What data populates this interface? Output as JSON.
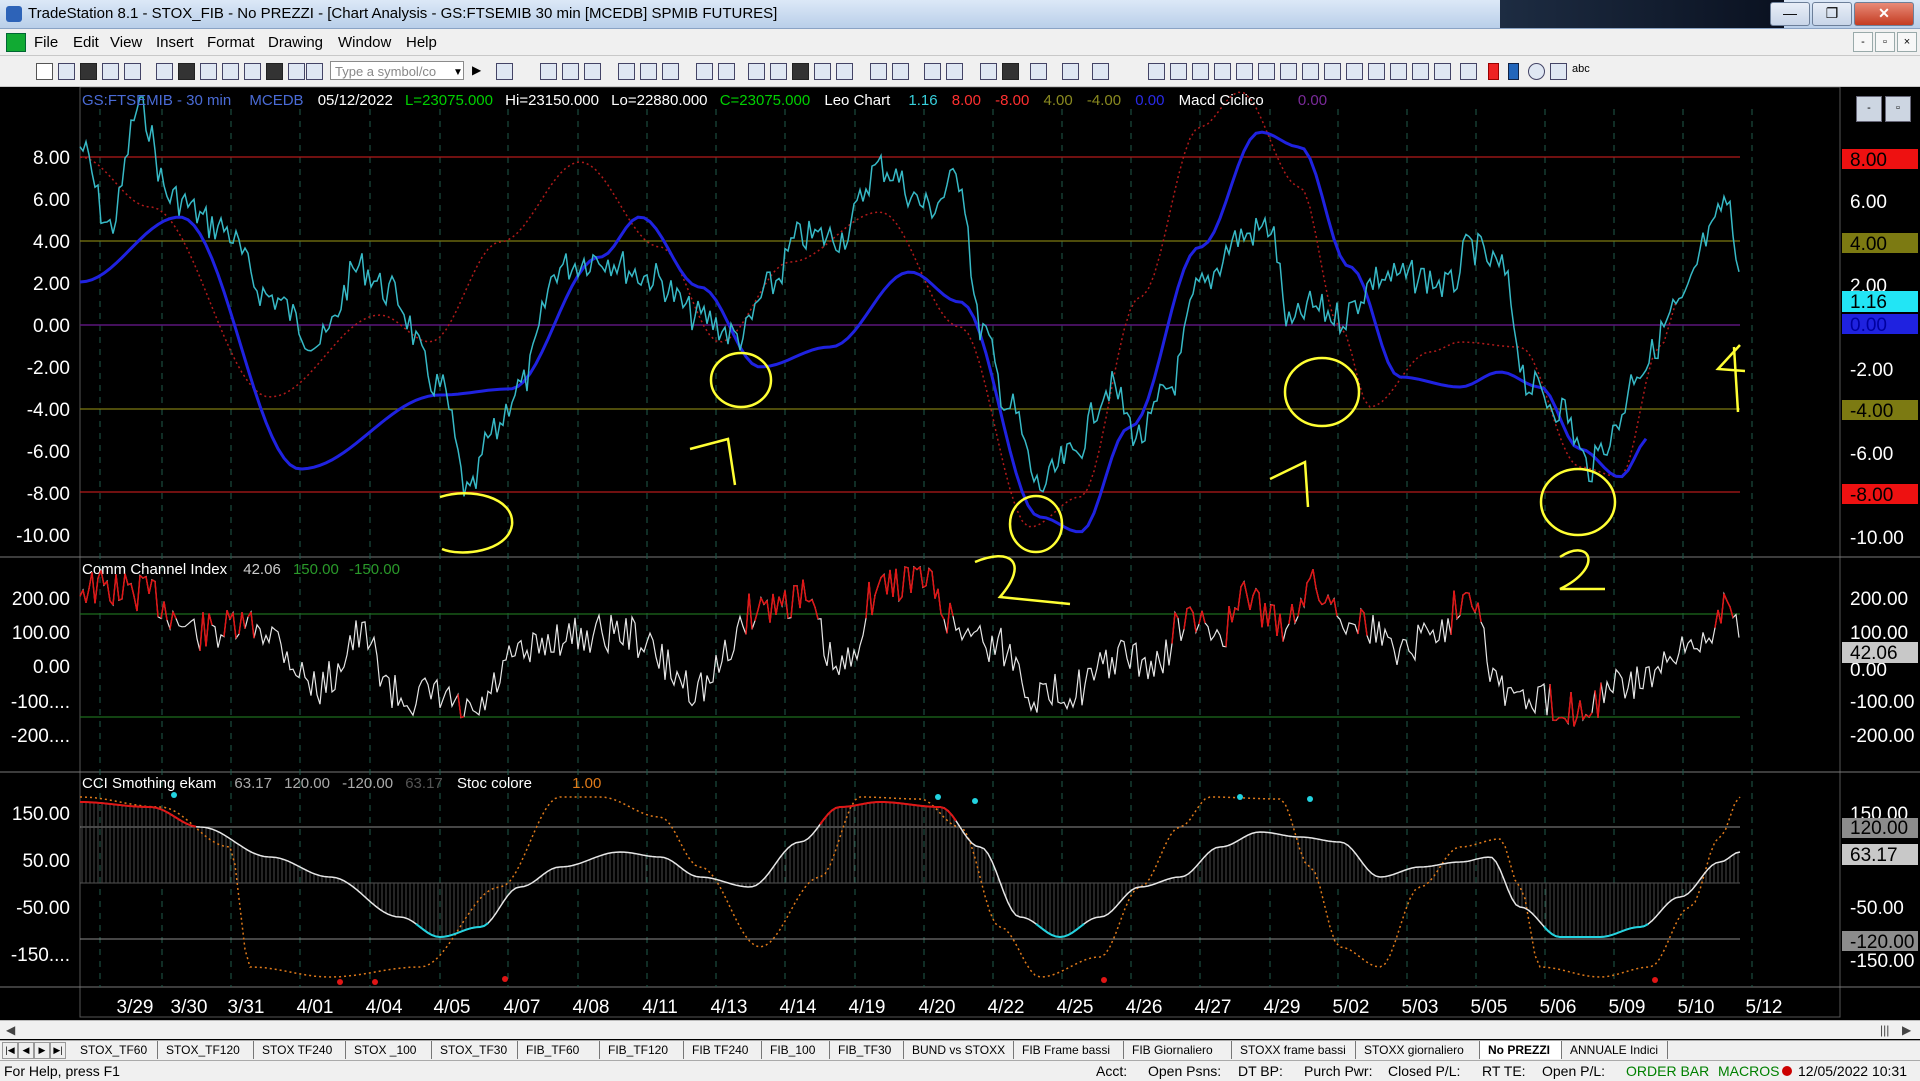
{
  "window": {
    "title": "TradeStation 8.1 - STOX_FIB - No PREZZI - [Chart Analysis - GS:FTSEMIB  30 min  [MCEDB] SPMIB FUTURES]",
    "min_glyph": "—",
    "restore_glyph": "❐",
    "close_glyph": "✕",
    "mdi_min": "-",
    "mdi_restore": "▫",
    "mdi_close": "×"
  },
  "menu": {
    "items": [
      "File",
      "Edit",
      "View",
      "Insert",
      "Format",
      "Drawing",
      "Window",
      "Help"
    ]
  },
  "toolbar": {
    "symbol_placeholder": "Type a symbol/co",
    "dropdown_glyph": "▼",
    "abc_label": "abc"
  },
  "chart_header": {
    "symbol": "GS:FTSEMIB - 30 min",
    "datasource": "MCEDB",
    "date": "05/12/2022",
    "last": "L=23075.000",
    "high": "Hi=23150.000",
    "low": "Lo=22880.000",
    "close": "C=23075.000",
    "indicator1": "Leo Chart",
    "ind_values": [
      "1.16",
      "8.00",
      "-8.00",
      "4.00",
      "-4.00",
      "0.00"
    ],
    "indicator2": "Macd Ciclico",
    "ind2_value": "0.00"
  },
  "panel1": {
    "y_labels": [
      "8.00",
      "6.00",
      "4.00",
      "2.00",
      "0.00",
      "-2.00",
      "-4.00",
      "-6.00",
      "-8.00",
      "-10.00"
    ],
    "right_labels": [
      "8.00",
      "6.00",
      "4.00",
      "2.00",
      "1.16",
      "0.00",
      "-2.00",
      "-4.00",
      "-6.00",
      "-8.00",
      "-10.00"
    ],
    "colors": {
      "cyan": "#37b9c6",
      "blue": "#1f22e0",
      "red": "#b31b1b",
      "yellow": "#ffff33"
    }
  },
  "panel2": {
    "title": "Comm Channel Index",
    "value": "42.06",
    "upper": "150.00",
    "lower": "-150.00",
    "y_labels": [
      "200.00",
      "100.00",
      "0.00",
      "-100....",
      "-200...."
    ],
    "right_labels": [
      "200.00",
      "100.00",
      "42.06",
      "0.00",
      "-100.00",
      "-200.00"
    ]
  },
  "panel3": {
    "title": "CCI Smothing ekam",
    "values": [
      "63.17",
      "120.00",
      "-120.00",
      "63.17"
    ],
    "stoc_title": "Stoc colore",
    "stoc_value": "1.00",
    "y_labels": [
      "150.00",
      "50.00",
      "-50.00",
      "-150...."
    ],
    "right_labels": [
      "150.00",
      "120.00",
      "63.17",
      "-50.00",
      "-120.00",
      "-150.00"
    ]
  },
  "x_axis": {
    "dates": [
      "3/29",
      "3/30",
      "3/31",
      "4/01",
      "4/04",
      "4/05",
      "4/07",
      "4/08",
      "4/11",
      "4/13",
      "4/14",
      "4/19",
      "4/20",
      "4/22",
      "4/25",
      "4/26",
      "4/27",
      "4/29",
      "5/02",
      "5/03",
      "5/05",
      "5/06",
      "5/09",
      "5/10",
      "5/12"
    ]
  },
  "annotations": [
    "3",
    "1",
    "2",
    "1",
    "2",
    "4"
  ],
  "tabs": [
    "STOX_TF60",
    "STOX_TF120",
    "STOX TF240",
    "STOX _100",
    "STOX_TF30",
    "FIB_TF60",
    "FIB_TF120",
    "FIB TF240",
    "FIB_100",
    "FIB_TF30",
    "BUND vs STOXX",
    "FIB Frame bassi",
    "FIB Giornaliero",
    "STOXX frame bassi",
    "STOXX giornaliero",
    "No PREZZI",
    "ANNUALE Indici"
  ],
  "status": {
    "help": "For Help, press F1",
    "acct": "Acct:",
    "open_psns": "Open Psns:",
    "dt_bp": "DT BP:",
    "purch_pwr": "Purch Pwr:",
    "closed_pl": "Closed P/L:",
    "rt_te": "RT TE:",
    "open_pl": "Open P/L:",
    "order_bar": "ORDER BAR",
    "macros": "MACROS",
    "datetime": "12/05/2022 10:31"
  }
}
